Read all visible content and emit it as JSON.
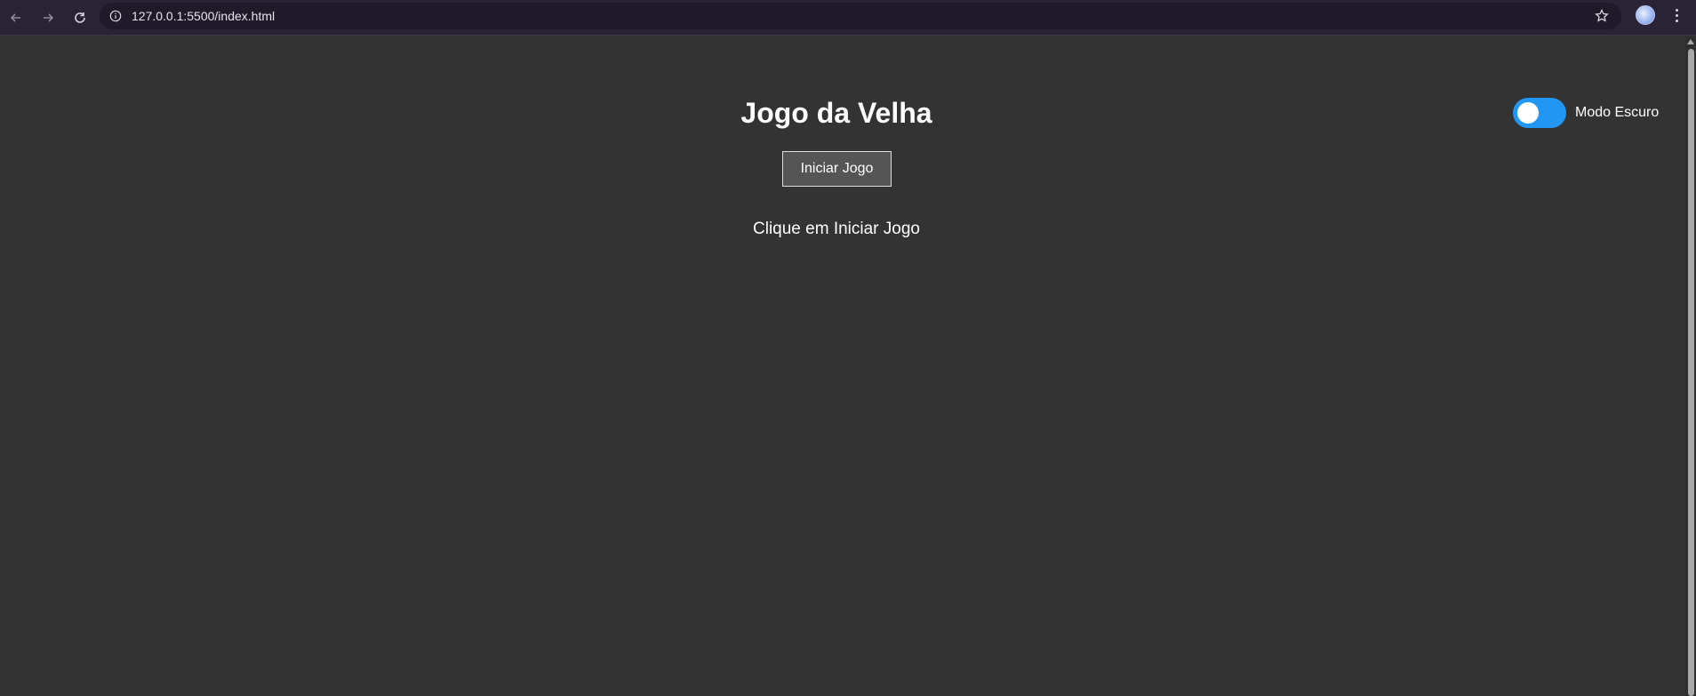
{
  "browser": {
    "url": "127.0.0.1:5500/index.html",
    "back_icon": "arrow-left-icon",
    "forward_icon": "arrow-right-icon",
    "reload_icon": "reload-icon",
    "site_info_icon": "info-icon",
    "bookmark_icon": "star-icon",
    "menu_icon": "kebab-menu-icon"
  },
  "game": {
    "title": "Jogo da Velha",
    "start_button_label": "Iniciar Jogo",
    "status_message": "Clique em Iniciar Jogo"
  },
  "theme_toggle": {
    "label": "Modo Escuro",
    "active_color": "#2196f3"
  },
  "colors": {
    "background": "#333333",
    "text": "#ffffff",
    "button_bg": "#555555"
  }
}
